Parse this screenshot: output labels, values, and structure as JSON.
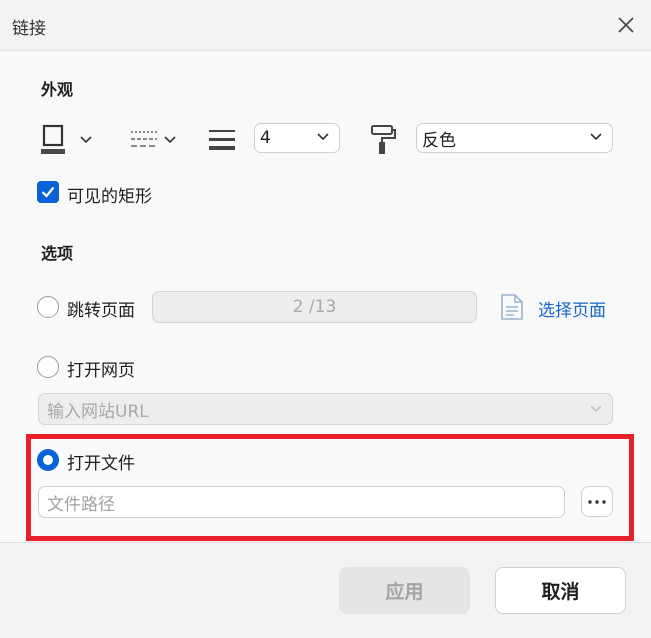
{
  "window": {
    "title": "链接"
  },
  "appearance": {
    "section_title": "外观",
    "line_width_value": "4",
    "highlight_value": "反色",
    "visible_rect_label": "可见的矩形",
    "visible_rect_checked": true
  },
  "options": {
    "section_title": "选项",
    "goto_page_label": "跳转页面",
    "page_indicator": "2 /13",
    "select_page_link": "选择页面",
    "open_web_label": "打开网页",
    "url_placeholder": "输入网站URL",
    "open_file_label": "打开文件",
    "file_path_placeholder": "文件路径",
    "selected": "open_file"
  },
  "footer": {
    "apply_label": "应用",
    "cancel_label": "取消"
  },
  "colors": {
    "accent": "#0a63d6",
    "link": "#1565c8",
    "highlight": "#e8202a"
  }
}
